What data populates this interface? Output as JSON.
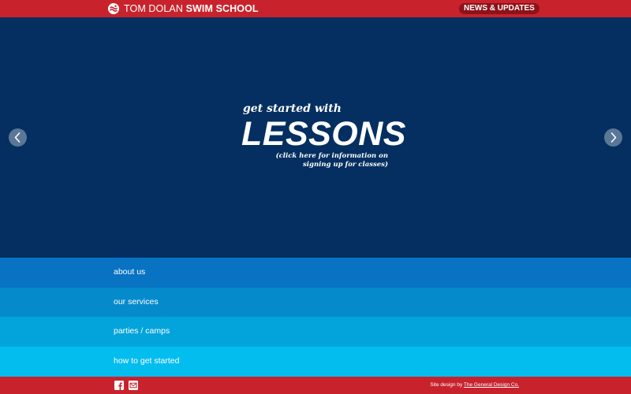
{
  "header": {
    "brand_light": "TOM DOLAN",
    "brand_bold": "SWIM SCHOOL",
    "news_label": "NEWS & UPDATES"
  },
  "hero": {
    "kicker": "get started with",
    "title": "LESSONS",
    "subtitle": "(click here for information on signing up for classes)",
    "background": "#042f60"
  },
  "nav": {
    "items": [
      {
        "label": "about us",
        "color": "#0773c2"
      },
      {
        "label": "our services",
        "color": "#058bcc"
      },
      {
        "label": "parties / camps",
        "color": "#03a4dc"
      },
      {
        "label": "how to get started",
        "color": "#04bdef"
      }
    ]
  },
  "footer": {
    "icons": [
      "facebook-icon",
      "email-icon"
    ],
    "credit_prefix": "Site design by",
    "credit_link": "The General Design Co."
  },
  "colors": {
    "accent_red": "#c8232c",
    "pill_dark_red": "#8d1219"
  }
}
